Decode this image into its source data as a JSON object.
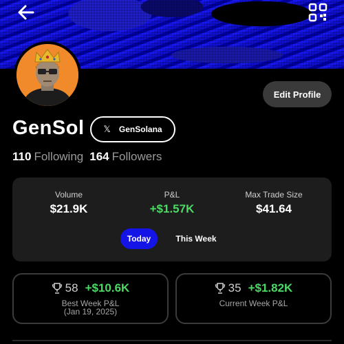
{
  "header": {
    "back_icon": "arrow-left-icon",
    "qr_icon": "qr-code-icon"
  },
  "profile": {
    "name": "GenSol",
    "x_handle": "GenSolana",
    "edit_label": "Edit Profile",
    "following_count": "110",
    "following_label": "Following",
    "followers_count": "164",
    "followers_label": "Followers"
  },
  "stats": {
    "volume_label": "Volume",
    "volume_value": "$21.9K",
    "pnl_label": "P&L",
    "pnl_value": "+$1.57K",
    "max_trade_label": "Max Trade Size",
    "max_trade_value": "$41.64",
    "tabs": [
      "Today",
      "This Week"
    ],
    "active_tab": "Today"
  },
  "best_week": {
    "rank": "58",
    "amount": "+$10.6K",
    "label": "Best Week P&L",
    "date": "(Jan 19, 2025)"
  },
  "current_week": {
    "rank": "35",
    "amount": "+$1.82K",
    "label": "Current Week P&L"
  },
  "colors": {
    "accent_blue": "#1414e6",
    "positive_green": "#4cd964",
    "avatar_bg": "#f08a2a",
    "card_bg": "#1d1d1d"
  }
}
